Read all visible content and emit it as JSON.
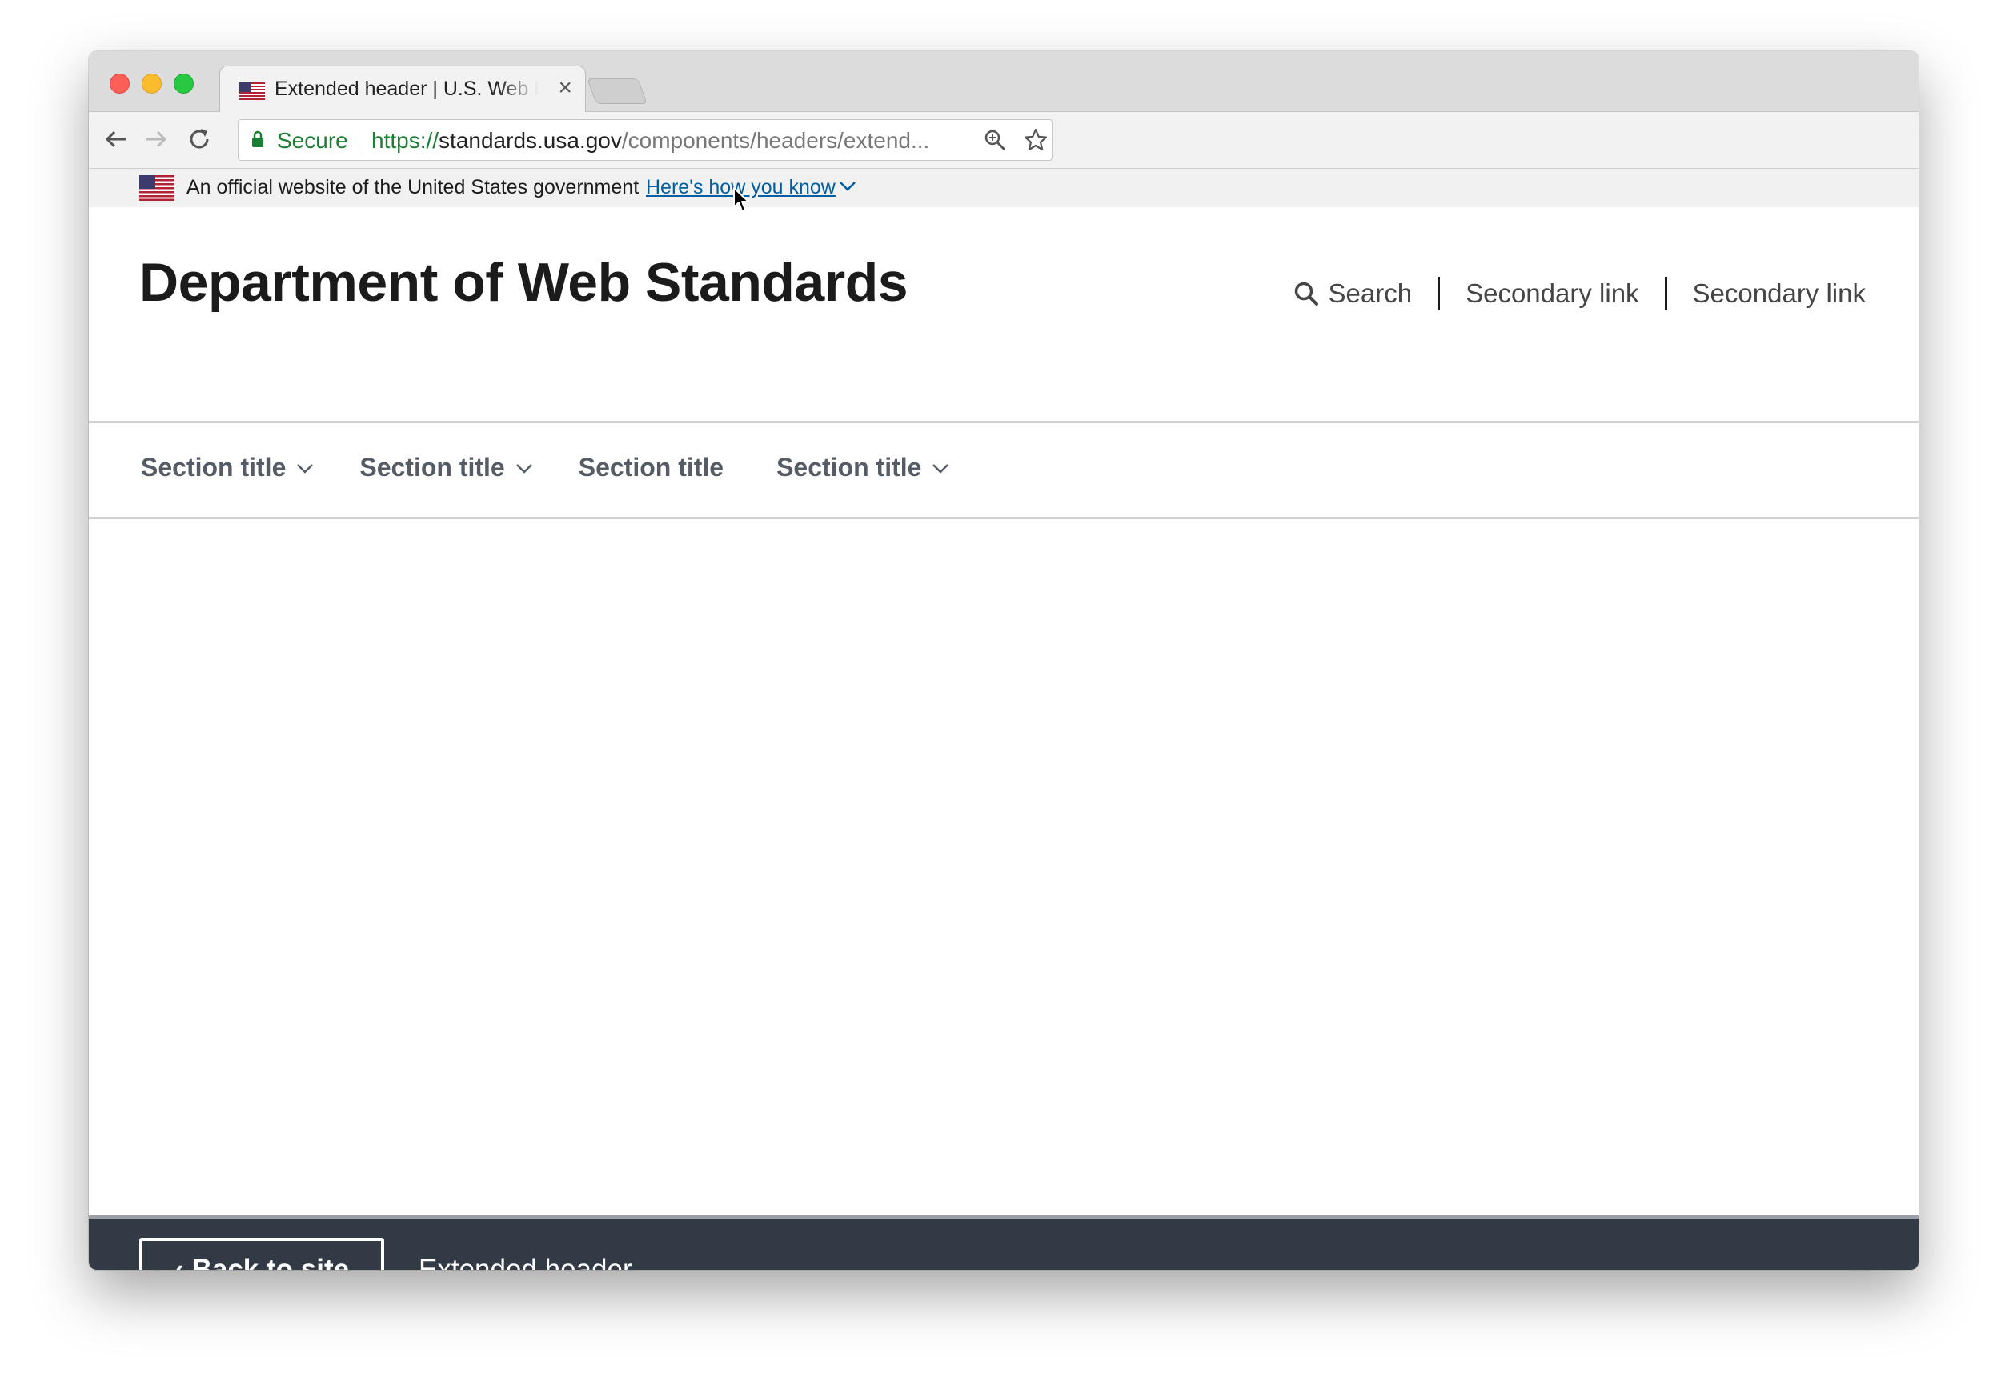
{
  "browser": {
    "tab_title": "Extended header | U.S. Web Design System",
    "secure_label": "Secure",
    "url_scheme": "https://",
    "url_host": "standards.usa.gov",
    "url_path": "/components/headers/extend..."
  },
  "gov_banner": {
    "official_text": "An official website of the United States government",
    "how_you_know_link": "Here's how you know"
  },
  "header": {
    "site_title": "Department of Web Standards",
    "search_label": "Search",
    "secondary_links": [
      "Secondary link",
      "Secondary link"
    ]
  },
  "primary_nav": {
    "items": [
      {
        "label": "Section title",
        "has_dropdown": true
      },
      {
        "label": "Section title",
        "has_dropdown": true
      },
      {
        "label": "Section title",
        "has_dropdown": false
      },
      {
        "label": "Section title",
        "has_dropdown": true
      }
    ]
  },
  "footer_bar": {
    "back_label": "Back to site",
    "page_label": "Extended header"
  },
  "colors": {
    "link_blue": "#005ea2",
    "footer_bg": "#323a45",
    "secure_green": "#1a7f32"
  }
}
